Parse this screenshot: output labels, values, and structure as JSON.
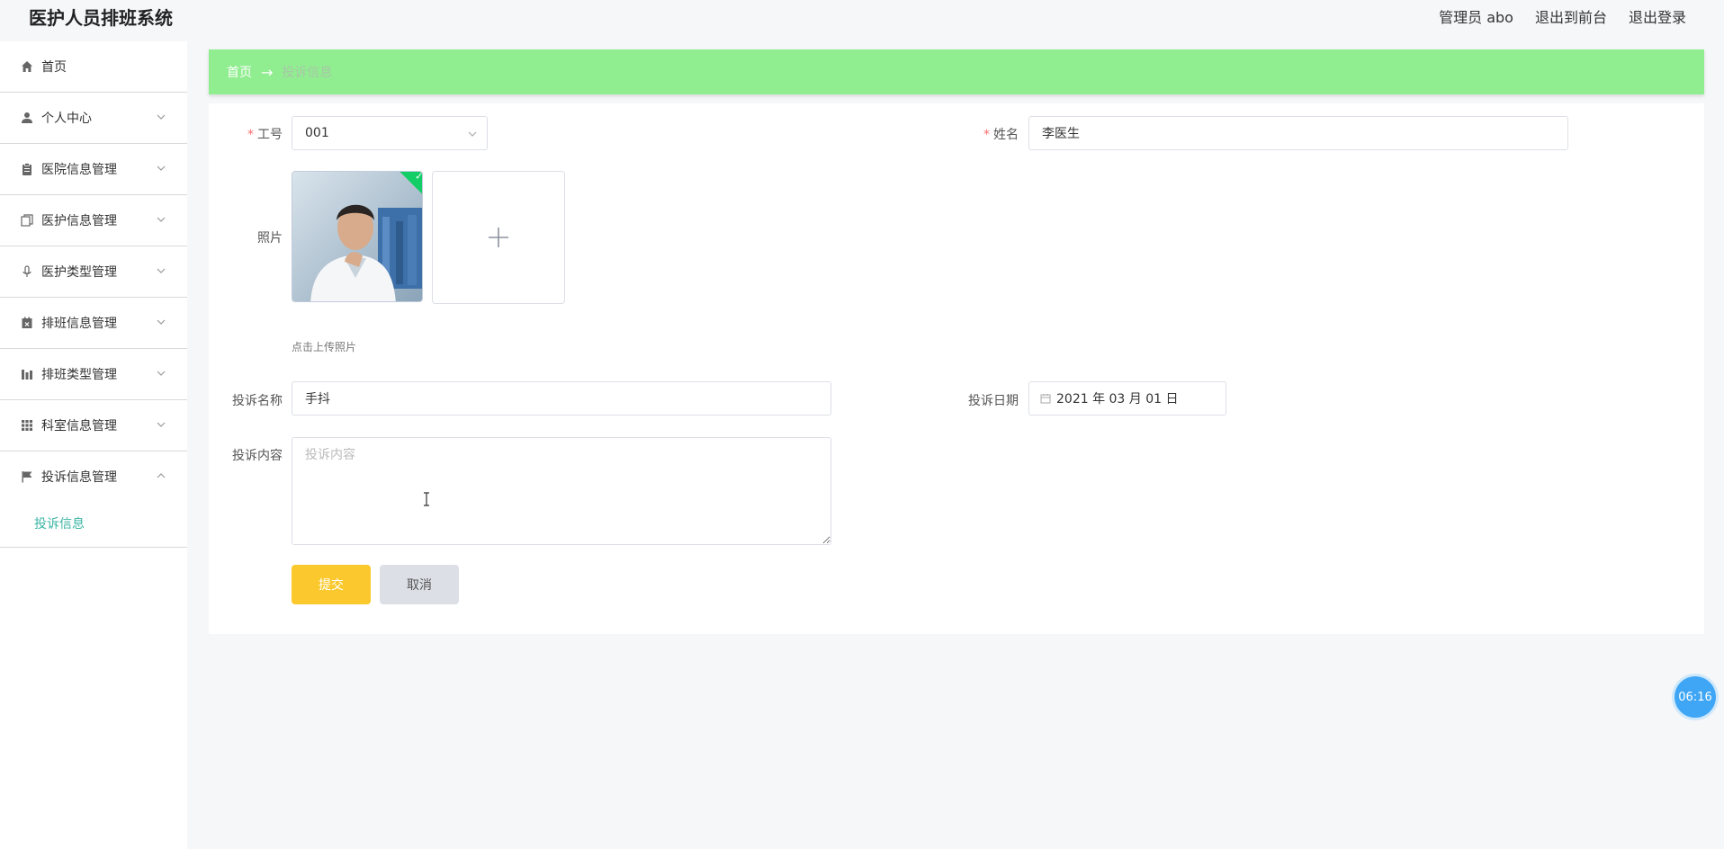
{
  "app": {
    "title": "医护人员排班系统"
  },
  "header": {
    "admin_label": "管理员 abo",
    "front_label": "退出到前台",
    "logout_label": "退出登录"
  },
  "sidebar": {
    "items": [
      {
        "label": "首页",
        "icon": "home-icon"
      },
      {
        "label": "个人中心",
        "icon": "user-icon"
      },
      {
        "label": "医院信息管理",
        "icon": "clipboard-icon"
      },
      {
        "label": "医护信息管理",
        "icon": "copy-icon"
      },
      {
        "label": "医护类型管理",
        "icon": "microphone-icon"
      },
      {
        "label": "排班信息管理",
        "icon": "calendar-x-icon"
      },
      {
        "label": "排班类型管理",
        "icon": "bar-chart-icon"
      },
      {
        "label": "科室信息管理",
        "icon": "grid-icon"
      },
      {
        "label": "投诉信息管理",
        "icon": "flag-icon"
      }
    ],
    "active_sub": "投诉信息"
  },
  "breadcrumb": {
    "home": "首页",
    "arrow": "→",
    "current": "投诉信息"
  },
  "form": {
    "job_no_label": "工号",
    "job_no_value": "001",
    "name_label": "姓名",
    "name_value": "李医生",
    "photo_label": "照片",
    "photo_hint": "点击上传照片",
    "complaint_name_label": "投诉名称",
    "complaint_name_value": "手抖",
    "complaint_date_label": "投诉日期",
    "complaint_date_value": "2021 年 03 月 01 日",
    "complaint_content_label": "投诉内容",
    "complaint_content_placeholder": "投诉内容",
    "submit_label": "提交",
    "cancel_label": "取消"
  },
  "clock": {
    "time": "06:16"
  },
  "colors": {
    "breadcrumb_bg": "#90ee90",
    "submit_bg": "#fbc92e",
    "active_menu": "#3bb5a4",
    "required": "#f56c6c"
  }
}
